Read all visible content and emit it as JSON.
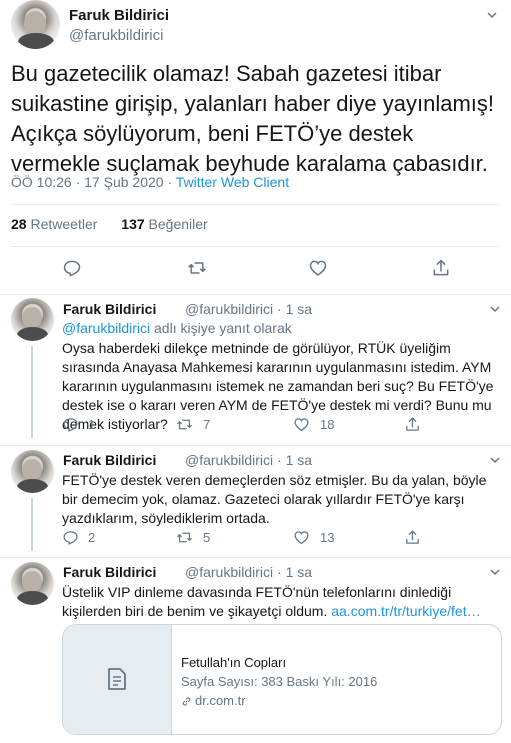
{
  "main_tweet": {
    "author_name": "Faruk Bildirici",
    "author_handle": "@farukbildirici",
    "text": "Bu gazetecilik olamaz! Sabah gazetesi itibar suikastine girişip, yalanları haber diye yayınlamış! Açıkça söylüyorum, beni FETÖ’ye destek vermekle suçlamak beyhude karalama çabasıdır.",
    "timestamp": "ÖÖ 10:26 · 17 Şub 2020 · ",
    "client": "Twitter Web Client",
    "retweets_count": "28",
    "retweets_label": "Retweetler",
    "likes_count": "137",
    "likes_label": "Beğeniler"
  },
  "replies": [
    {
      "author_name": "Faruk Bildirici",
      "handle_time": "@farukbildirici · 1 sa",
      "reply_to_handle": "@farukbildirici",
      "reply_to_text": " adlı kişiye yanıt olarak",
      "text": "Oysa haberdeki dilekçe metninde de görülüyor, RTÜK üyeliğim sırasında Anayasa Mahkemesi kararının uygulanmasını istedim. AYM kararının uygulanmasını istemek ne zamandan beri suç? Bu FETÖ'ye destek ise o kararı veren AYM de FETÖ'ye destek mi verdi? Bunu mu demek istiyorlar?",
      "reply_count": "1",
      "retweet_count": "7",
      "like_count": "18"
    },
    {
      "author_name": "Faruk Bildirici",
      "handle_time": "@farukbildirici · 1 sa",
      "text": "FETÖ'ye destek veren demeçlerden söz etmişler. Bu da yalan, böyle bir demecim yok, olamaz. Gazeteci olarak yıllardır FETÖ'ye karşı yazdıklarım, söylediklerim ortada.",
      "reply_count": "2",
      "retweet_count": "5",
      "like_count": "13"
    },
    {
      "author_name": "Faruk Bildirici",
      "handle_time": "@farukbildirici · 1 sa",
      "text": "Üstelik VIP dinleme davasında FETÖ'nün telefonlarını dinlediği kişilerden biri de benim ve şikayetçi oldum. ",
      "link": "aa.com.tr/tr/turkiye/fet…",
      "card": {
        "title": "Fetullah'ın Copları",
        "description": "Sayfa Sayısı: 383 Baskı Yılı: 2016",
        "domain": "dr.com.tr"
      }
    }
  ],
  "icons": {
    "reply": "reply-icon",
    "retweet": "retweet-icon",
    "like": "heart-icon",
    "share": "share-icon",
    "more": "chevron-down-icon",
    "card": "document-icon",
    "link": "link-icon"
  },
  "colors": {
    "link": "#1b95e0",
    "secondary_text": "#657786",
    "border": "#e6ecf0"
  }
}
